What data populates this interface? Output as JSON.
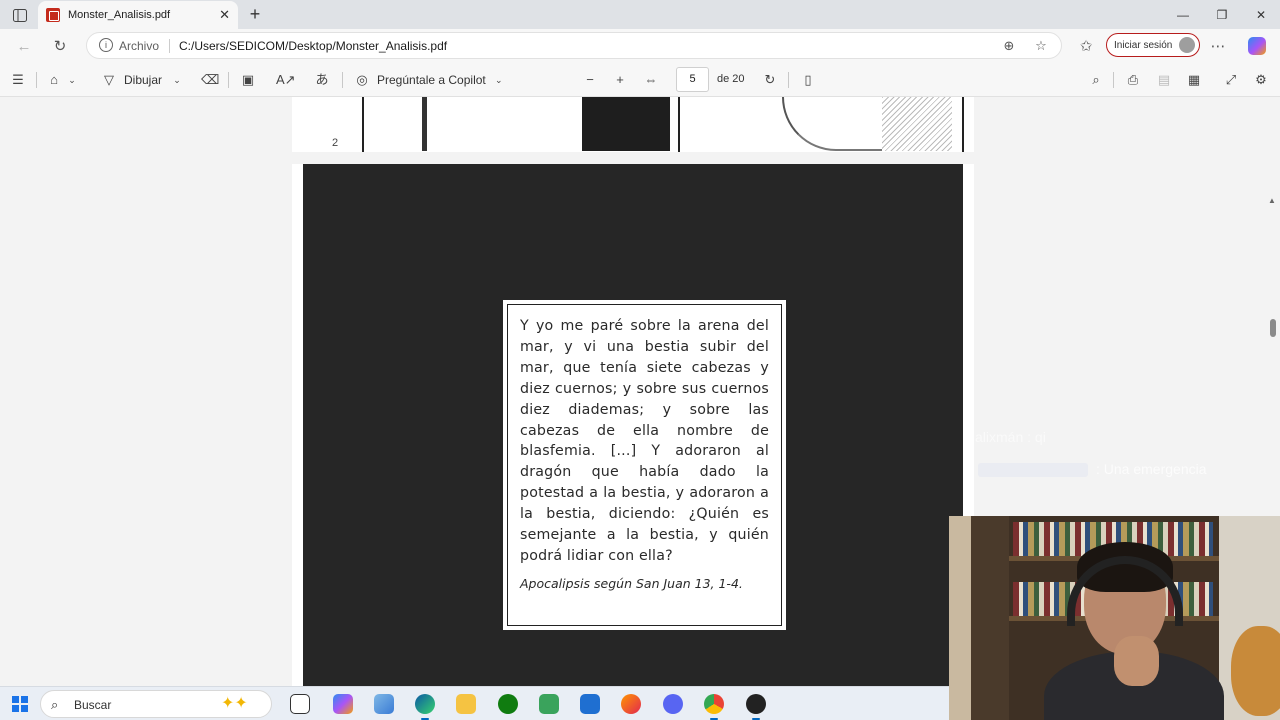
{
  "browser": {
    "tab_title": "Monster_Analisis.pdf",
    "origin_label": "Archivo",
    "url": "C:/Users/SEDICOM/Desktop/Monster_Analisis.pdf",
    "signin_label": "Iniciar sesión"
  },
  "pdf_toolbar": {
    "draw_label": "Dibujar",
    "copilot_label": "Pregúntale a Copilot",
    "page_current": "5",
    "page_of": "de 20"
  },
  "page": {
    "prev_page_number": "2",
    "quote_text": "Y yo me paré sobre la arena del mar, y vi una bestia subir del mar, que tenía siete cabezas y diez cuernos; y sobre sus cuernos diez diademas; y sobre las cabezas de ella nombre de blasfemia. [...] Y adoraron al dragón que había dado la potestad a la bestia, y adoraron a la bestia, diciendo: ¿Quién es semejante a la bestia, y quién podrá lidiar con ella?",
    "quote_citation": "Apocalipsis según San Juan 13, 1-4."
  },
  "overlay": {
    "chat_line_1": "alixmán : qi",
    "chat_line_2": ": Una emergencia"
  },
  "taskbar": {
    "search_placeholder": "Buscar",
    "apps": [
      "task-view",
      "copilot",
      "files-app",
      "edge",
      "file-explorer",
      "xbox",
      "money-app",
      "notes-app",
      "firefox",
      "discord",
      "chrome",
      "obs"
    ]
  },
  "colors": {
    "signin_border": "#b71c1c",
    "accent": "#0067c0"
  }
}
